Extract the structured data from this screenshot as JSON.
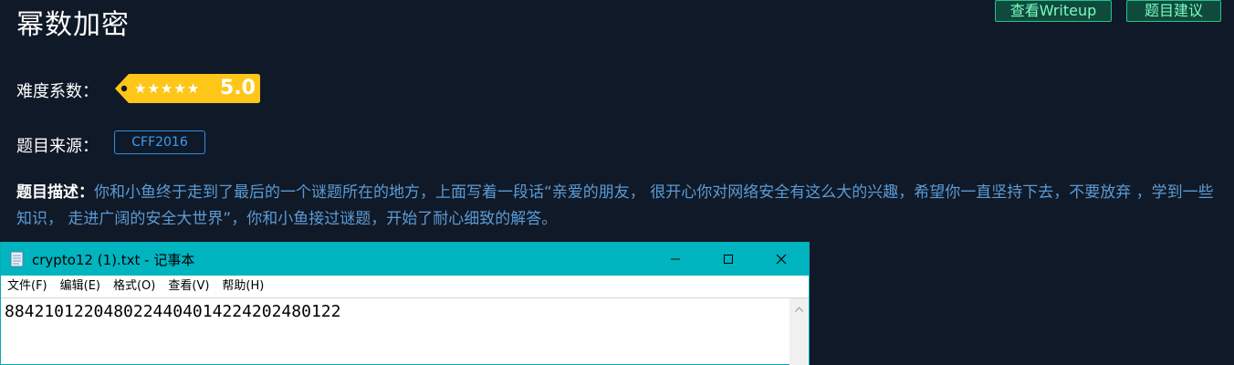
{
  "page": {
    "title": "幂数加密",
    "buttons": {
      "writeup": "查看Writeup",
      "suggest": "题目建议"
    }
  },
  "difficulty": {
    "label": "难度系数：",
    "stars": 5,
    "score": "5.0",
    "star_glyph": "★"
  },
  "source": {
    "label": "题目来源：",
    "value": "CFF2016"
  },
  "description": {
    "label": "题目描述：",
    "text": "你和小鱼终于走到了最后的一个谜题所在的地方，上面写着一段话“亲爱的朋友， 很开心你对网络安全有这么大的兴趣，希望你一直坚持下去，不要放弃 ，学到一些知识， 走进广阔的安全大世界”，你和小鱼接过谜题，开始了耐心细致的解答。"
  },
  "notepad": {
    "title": "crypto12 (1).txt - 记事本",
    "menu": [
      "文件(F)",
      "编辑(E)",
      "格式(O)",
      "查看(V)",
      "帮助(H)"
    ],
    "content": "8842101220480224404014224202480122",
    "icons": {
      "file": "notepad-file-icon",
      "minimize": "minimize-icon",
      "maximize": "maximize-icon",
      "close": "close-icon"
    }
  },
  "colors": {
    "background": "#101927",
    "button_border": "#21c28e",
    "button_text": "#7dfcc2",
    "tag_yellow": "#ffc61a",
    "source_blue": "#3e9bf0",
    "description_blue": "#5b9bd5",
    "notepad_titlebar": "#00b4c0"
  }
}
